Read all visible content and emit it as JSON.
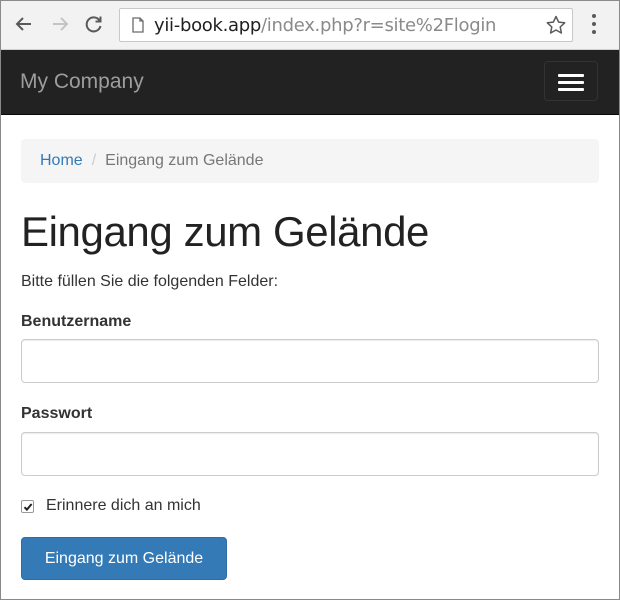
{
  "browser": {
    "url_host": "yii-book.app",
    "url_path": "/index.php?r=site%2Flogin"
  },
  "navbar": {
    "brand": "My Company"
  },
  "breadcrumb": {
    "home": "Home",
    "separator": "/",
    "current": "Eingang zum Gelände"
  },
  "page": {
    "title": "Eingang zum Gelände",
    "intro": "Bitte füllen Sie die folgenden Felder:"
  },
  "form": {
    "username_label": "Benutzername",
    "username_value": "",
    "password_label": "Passwort",
    "password_value": "",
    "remember_label": "Erinnere dich an mich",
    "remember_checked": true,
    "submit_label": "Eingang zum Gelände"
  },
  "colors": {
    "navbar_bg": "#222222",
    "primary": "#337ab7",
    "link": "#337ab7",
    "breadcrumb_bg": "#f5f5f5"
  },
  "icons": {
    "back": "back-arrow-icon",
    "forward": "forward-arrow-icon",
    "reload": "reload-icon",
    "page": "page-icon",
    "bookmark": "star-icon",
    "menu": "vertical-dots-icon",
    "nav_toggle": "hamburger-icon"
  }
}
